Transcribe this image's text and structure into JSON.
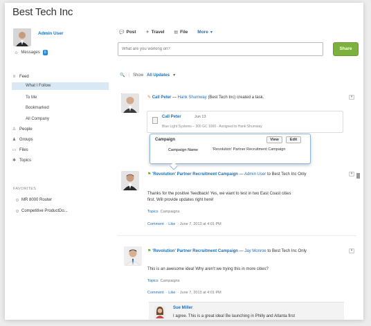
{
  "app": {
    "title": "Best Tech Inc"
  },
  "sidebar": {
    "user_name": "Admin User",
    "messages_label": "Messages",
    "messages_count": "0",
    "feed_label": "Feed",
    "feed_items": [
      "What I Follow",
      "To Me",
      "Bookmarked",
      "All Company"
    ],
    "people_label": "People",
    "groups_label": "Groups",
    "files_label": "Files",
    "topics_label": "Topics",
    "favorites_title": "FAVORITES",
    "favorites": [
      "MR 8000 Router",
      "Competitive ProductDo..."
    ]
  },
  "publisher": {
    "tabs": [
      "Post",
      "Travel",
      "File",
      "More"
    ],
    "placeholder": "What are you working on?",
    "share_label": "Share"
  },
  "filter": {
    "show_label": "Show",
    "value": "All Updates"
  },
  "feed": {
    "post1": {
      "author": "Call Peter",
      "dash": "—",
      "recipient": "Hank Shumway",
      "recipient_tail": "(Best Tech Inc)",
      "action": "created a task.",
      "task_name": "Call Peter",
      "task_date": "Jun 13",
      "task_detail": "Blue Light Systems – 300 GC 1000 · Assigned to Hank Shumway"
    },
    "hover_card": {
      "title": "Campaign",
      "view_label": "View",
      "edit_label": "Edit",
      "field_label": "Campaign Name",
      "field_value": "'Revolution' Partner Recruitment Campaign"
    },
    "post2": {
      "title": "'Revolution' Partner Recruitment Campaign",
      "dash": "—",
      "author": "Admin User",
      "to_text": "to Best Tech Inc Only",
      "body_line1": "Thanks for the positive 'feedback! Yes, we want to test in two East Coast cities",
      "body_line2": "first. Will provide updates right here!",
      "topics_label": "Topics",
      "topic": "Campaigns",
      "comment_label": "Comment",
      "like_label": "Like",
      "timestamp": "June 7, 2013 at 4:01 PM"
    },
    "post3": {
      "title": "'Revolution' Partner Recruitment Campaign",
      "dash": "—",
      "author": "Jay Monroe",
      "to_text": "to Best Tech Inc Only",
      "body_line1": "This is an awesome idea! Why aren't we trying this in more cities?",
      "topics_label": "Topics",
      "topic": "Campaigns",
      "comment_label": "Comment",
      "like_label": "Like",
      "timestamp": "June 7, 2013 at 4:01 PM"
    },
    "reply": {
      "author": "Sue Miller",
      "text": "I agree. This is a great idea! Be launching in Philly and Atlanta first"
    }
  }
}
